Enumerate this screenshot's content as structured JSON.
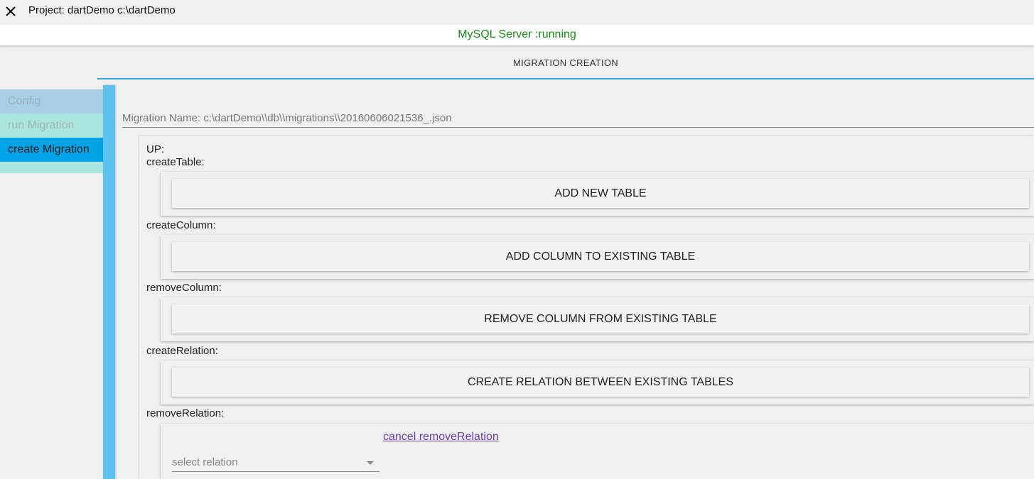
{
  "titlebar": {
    "close_icon": "close-icon",
    "title": "Project: dartDemo c:\\dartDemo"
  },
  "status": {
    "text": "MySQL Server :running",
    "color": "#1e8a1e"
  },
  "tab": {
    "label": "MIGRATION CREATION",
    "accent": "#2ea7dd"
  },
  "sidebar": {
    "items": [
      {
        "label": "Config"
      },
      {
        "label": "run Migration"
      },
      {
        "label": "create Migration",
        "active": true
      }
    ]
  },
  "main": {
    "migration_name": "Migration Name: c:\\dartDemo\\\\db\\\\migrations\\\\20160606021536_.json",
    "up_label": "UP:",
    "sections": [
      {
        "label": "createTable:",
        "button": "ADD NEW TABLE"
      },
      {
        "label": "createColumn:",
        "button": "ADD COLUMN TO EXISTING TABLE"
      },
      {
        "label": "removeColumn:",
        "button": "REMOVE COLUMN FROM EXISTING TABLE"
      },
      {
        "label": "createRelation:",
        "button": "CREATE RELATION BETWEEN EXISTING TABLES"
      }
    ],
    "remove_relation": {
      "label": "removeRelation:",
      "cancel_link": "cancel removeRelation",
      "select_placeholder": "select relation"
    }
  }
}
